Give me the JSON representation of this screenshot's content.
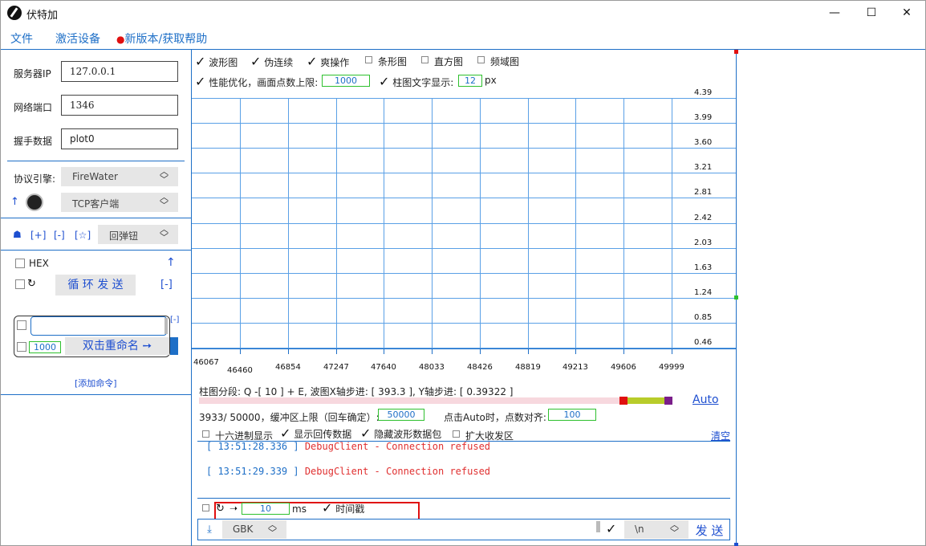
{
  "window": {
    "title": "伏特加",
    "min": "—",
    "max": "☐",
    "close": "✕"
  },
  "menu": {
    "file": "文件",
    "activate": "激活设备",
    "dot": "●",
    "update": "新版本/获取帮助"
  },
  "left": {
    "server_ip_label": "服务器IP",
    "server_ip": "127.0.0.1",
    "port_label": "网络端口",
    "port": "1346",
    "handshake_label": "握手数据",
    "handshake": "plot0",
    "protocol_label": "协议引擎:",
    "protocol": "FireWater",
    "up_arrow": "↑",
    "conn_type": "TCP客户端",
    "add": "[+]",
    "remove": "[-]",
    "star": "[☆]",
    "rebound": "回弹钮",
    "hex_label": "HEX",
    "up_arrow2": "↑",
    "loop_icon": "↻",
    "loop_send": "循 环 发 送",
    "minus": "[-]",
    "cmd_minus": "[-]",
    "cmd_interval": "1000",
    "cmd_name": "双击重命名 ➙",
    "add_cmd": "[添加命令]"
  },
  "top_opts": {
    "waveform": "波形图",
    "pseudo": "伪连续",
    "crazy": "爽操作",
    "bar": "条形图",
    "histogram": "直方图",
    "freq": "频域图",
    "perf": "性能优化，画面点数上限:",
    "perf_val": "1000",
    "bartext": "柱图文字显示:",
    "bartext_val": "12",
    "px": "px"
  },
  "chart_data": {
    "type": "line",
    "yticks": [
      "4.39",
      "3.99",
      "3.60",
      "3.21",
      "2.81",
      "2.42",
      "2.03",
      "1.63",
      "1.24",
      "0.85",
      "0.46"
    ],
    "xticks": [
      "46067",
      "46460",
      "46854",
      "47247",
      "47640",
      "48033",
      "48426",
      "48819",
      "49213",
      "49606",
      "49999"
    ],
    "series": []
  },
  "status": {
    "seg": "柱图分段: Q -[ 10 ] + E,  波图X轴步进: [ 393.3 ],  Y轴步进: [ 0.39322 ]",
    "auto": "Auto",
    "buffer": "3933/ 50000，缓冲区上限（回车确定）:",
    "buffer_val": "50000",
    "align": "点击Auto时，点数对齐:",
    "align_val": "100"
  },
  "rx_opts": {
    "hex": "十六进制显示",
    "echo": "显示回传数据",
    "hide": "隐藏波形数据包",
    "expand": "扩大收发区",
    "clear": "清空"
  },
  "log": [
    {
      "time": "[ 13:51:28.336 ]",
      "msg": "DebugClient - Connection refused"
    },
    {
      "time": "[ 13:51:29.339 ]",
      "msg": "DebugClient - Connection refused"
    }
  ],
  "send": {
    "loop": "↻",
    "arrow": "➝",
    "interval": "10",
    "ms": "ms",
    "timestamp": "时间戳",
    "down": "⤓",
    "encoding": "GBK",
    "newline": "\\n",
    "send": "发 送"
  },
  "colors": {
    "accent": "#1e6fc7",
    "red": "#e01010",
    "green": "#2ec02e",
    "log_red": "#e03030"
  }
}
